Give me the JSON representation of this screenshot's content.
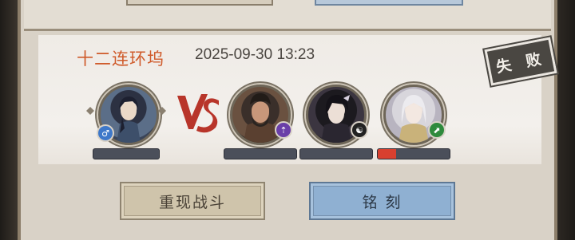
{
  "battle": {
    "title": "十二连环坞",
    "timestamp": "2025-09-30 13:23",
    "result": "失 败",
    "vs_label": "VS"
  },
  "player": {
    "badge_icon": "male-symbol",
    "hp_fraction": 0
  },
  "enemies": [
    {
      "badge_icon": "purple-arrow-icon",
      "hp_fraction": 0
    },
    {
      "badge_icon": "yin-yang-icon",
      "hp_fraction": 0
    },
    {
      "badge_icon": "green-boot-icon",
      "hp_fraction": 0.25
    }
  ],
  "buttons": {
    "replay_label": "重现战斗",
    "engrave_label": "铭 刻"
  },
  "colors": {
    "title": "#cf5a2a",
    "replay_button": "#cfc4ab",
    "engrave_button": "#8fb0d2",
    "hp_bar_fill": "#d8402f",
    "hp_bar_empty": "#4b4f5a"
  }
}
